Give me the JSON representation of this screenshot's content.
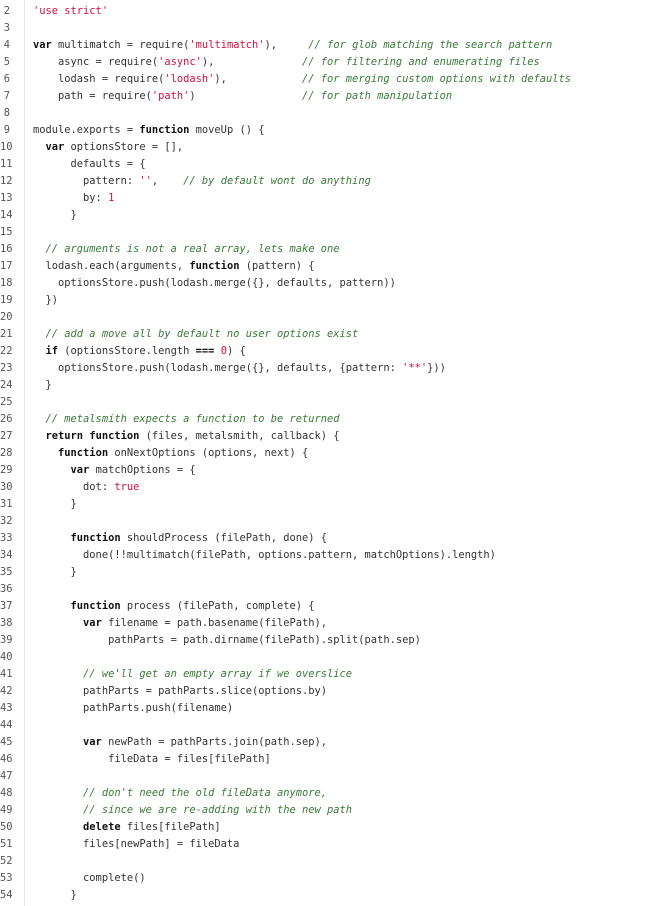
{
  "colors": {
    "background": "#ffffff",
    "plain": "#333333",
    "keyword": "#111111",
    "string": "#d01040",
    "number": "#d01040",
    "comment": "#3a7a3a",
    "line_number": "#555555",
    "gutter_rule": "#e4e4e4"
  },
  "lines": [
    {
      "n": "2",
      "tokens": [
        {
          "t": "string",
          "v": "'use strict'"
        }
      ]
    },
    {
      "n": "3",
      "tokens": []
    },
    {
      "n": "4",
      "tokens": [
        {
          "t": "keyword",
          "v": "var"
        },
        {
          "t": "plain",
          "v": " multimatch = require("
        },
        {
          "t": "string",
          "v": "'multimatch'"
        },
        {
          "t": "plain",
          "v": "),     "
        },
        {
          "t": "comment",
          "v": "// for glob matching the search pattern"
        }
      ]
    },
    {
      "n": "5",
      "tokens": [
        {
          "t": "plain",
          "v": "    async = require("
        },
        {
          "t": "string",
          "v": "'async'"
        },
        {
          "t": "plain",
          "v": "),              "
        },
        {
          "t": "comment",
          "v": "// for filtering and enumerating files"
        }
      ]
    },
    {
      "n": "6",
      "tokens": [
        {
          "t": "plain",
          "v": "    lodash = require("
        },
        {
          "t": "string",
          "v": "'lodash'"
        },
        {
          "t": "plain",
          "v": "),            "
        },
        {
          "t": "comment",
          "v": "// for merging custom options with defaults"
        }
      ]
    },
    {
      "n": "7",
      "tokens": [
        {
          "t": "plain",
          "v": "    path = require("
        },
        {
          "t": "string",
          "v": "'path'"
        },
        {
          "t": "plain",
          "v": ")                 "
        },
        {
          "t": "comment",
          "v": "// for path manipulation"
        }
      ]
    },
    {
      "n": "8",
      "tokens": []
    },
    {
      "n": "9",
      "tokens": [
        {
          "t": "plain",
          "v": "module.exports = "
        },
        {
          "t": "keyword",
          "v": "function"
        },
        {
          "t": "plain",
          "v": " moveUp () {"
        }
      ]
    },
    {
      "n": "10",
      "tokens": [
        {
          "t": "plain",
          "v": "  "
        },
        {
          "t": "keyword",
          "v": "var"
        },
        {
          "t": "plain",
          "v": " optionsStore = [],"
        }
      ]
    },
    {
      "n": "11",
      "tokens": [
        {
          "t": "plain",
          "v": "      defaults = {"
        }
      ]
    },
    {
      "n": "12",
      "tokens": [
        {
          "t": "plain",
          "v": "        pattern: "
        },
        {
          "t": "string",
          "v": "''"
        },
        {
          "t": "plain",
          "v": ",    "
        },
        {
          "t": "comment",
          "v": "// by default wont do anything"
        }
      ]
    },
    {
      "n": "13",
      "tokens": [
        {
          "t": "plain",
          "v": "        by: "
        },
        {
          "t": "number",
          "v": "1"
        }
      ]
    },
    {
      "n": "14",
      "tokens": [
        {
          "t": "plain",
          "v": "      }"
        }
      ]
    },
    {
      "n": "15",
      "tokens": []
    },
    {
      "n": "16",
      "tokens": [
        {
          "t": "plain",
          "v": "  "
        },
        {
          "t": "comment",
          "v": "// arguments is not a real array, lets make one"
        }
      ]
    },
    {
      "n": "17",
      "tokens": [
        {
          "t": "plain",
          "v": "  lodash.each(arguments, "
        },
        {
          "t": "keyword",
          "v": "function"
        },
        {
          "t": "plain",
          "v": " (pattern) {"
        }
      ]
    },
    {
      "n": "18",
      "tokens": [
        {
          "t": "plain",
          "v": "    optionsStore.push(lodash.merge({}, defaults, pattern))"
        }
      ]
    },
    {
      "n": "19",
      "tokens": [
        {
          "t": "plain",
          "v": "  })"
        }
      ]
    },
    {
      "n": "20",
      "tokens": []
    },
    {
      "n": "21",
      "tokens": [
        {
          "t": "plain",
          "v": "  "
        },
        {
          "t": "comment",
          "v": "// add a move all by default no user options exist"
        }
      ]
    },
    {
      "n": "22",
      "tokens": [
        {
          "t": "plain",
          "v": "  "
        },
        {
          "t": "keyword",
          "v": "if"
        },
        {
          "t": "plain",
          "v": " (optionsStore.length "
        },
        {
          "t": "keyword",
          "v": "==="
        },
        {
          "t": "plain",
          "v": " "
        },
        {
          "t": "number",
          "v": "0"
        },
        {
          "t": "plain",
          "v": ") {"
        }
      ]
    },
    {
      "n": "23",
      "tokens": [
        {
          "t": "plain",
          "v": "    optionsStore.push(lodash.merge({}, defaults, {pattern: "
        },
        {
          "t": "string",
          "v": "'**'"
        },
        {
          "t": "plain",
          "v": "}))"
        }
      ]
    },
    {
      "n": "24",
      "tokens": [
        {
          "t": "plain",
          "v": "  }"
        }
      ]
    },
    {
      "n": "25",
      "tokens": []
    },
    {
      "n": "26",
      "tokens": [
        {
          "t": "plain",
          "v": "  "
        },
        {
          "t": "comment",
          "v": "// metalsmith expects a function to be returned"
        }
      ]
    },
    {
      "n": "27",
      "tokens": [
        {
          "t": "plain",
          "v": "  "
        },
        {
          "t": "keyword",
          "v": "return"
        },
        {
          "t": "plain",
          "v": " "
        },
        {
          "t": "keyword",
          "v": "function"
        },
        {
          "t": "plain",
          "v": " (files, metalsmith, callback) {"
        }
      ]
    },
    {
      "n": "28",
      "tokens": [
        {
          "t": "plain",
          "v": "    "
        },
        {
          "t": "keyword",
          "v": "function"
        },
        {
          "t": "plain",
          "v": " onNextOptions (options, next) {"
        }
      ]
    },
    {
      "n": "29",
      "tokens": [
        {
          "t": "plain",
          "v": "      "
        },
        {
          "t": "keyword",
          "v": "var"
        },
        {
          "t": "plain",
          "v": " matchOptions = {"
        }
      ]
    },
    {
      "n": "30",
      "tokens": [
        {
          "t": "plain",
          "v": "        dot: "
        },
        {
          "t": "string",
          "v": "true"
        }
      ]
    },
    {
      "n": "31",
      "tokens": [
        {
          "t": "plain",
          "v": "      }"
        }
      ]
    },
    {
      "n": "32",
      "tokens": []
    },
    {
      "n": "33",
      "tokens": [
        {
          "t": "plain",
          "v": "      "
        },
        {
          "t": "keyword",
          "v": "function"
        },
        {
          "t": "plain",
          "v": " shouldProcess (filePath, done) {"
        }
      ]
    },
    {
      "n": "34",
      "tokens": [
        {
          "t": "plain",
          "v": "        done(!!multimatch(filePath, options.pattern, matchOptions).length)"
        }
      ]
    },
    {
      "n": "35",
      "tokens": [
        {
          "t": "plain",
          "v": "      }"
        }
      ]
    },
    {
      "n": "36",
      "tokens": []
    },
    {
      "n": "37",
      "tokens": [
        {
          "t": "plain",
          "v": "      "
        },
        {
          "t": "keyword",
          "v": "function"
        },
        {
          "t": "plain",
          "v": " process (filePath, complete) {"
        }
      ]
    },
    {
      "n": "38",
      "tokens": [
        {
          "t": "plain",
          "v": "        "
        },
        {
          "t": "keyword",
          "v": "var"
        },
        {
          "t": "plain",
          "v": " filename = path.basename(filePath),"
        }
      ]
    },
    {
      "n": "39",
      "tokens": [
        {
          "t": "plain",
          "v": "            pathParts = path.dirname(filePath).split(path.sep)"
        }
      ]
    },
    {
      "n": "40",
      "tokens": []
    },
    {
      "n": "41",
      "tokens": [
        {
          "t": "plain",
          "v": "        "
        },
        {
          "t": "comment",
          "v": "// we'll get an empty array if we overslice"
        }
      ]
    },
    {
      "n": "42",
      "tokens": [
        {
          "t": "plain",
          "v": "        pathParts = pathParts.slice(options.by)"
        }
      ]
    },
    {
      "n": "43",
      "tokens": [
        {
          "t": "plain",
          "v": "        pathParts.push(filename)"
        }
      ]
    },
    {
      "n": "44",
      "tokens": []
    },
    {
      "n": "45",
      "tokens": [
        {
          "t": "plain",
          "v": "        "
        },
        {
          "t": "keyword",
          "v": "var"
        },
        {
          "t": "plain",
          "v": " newPath = pathParts.join(path.sep),"
        }
      ]
    },
    {
      "n": "46",
      "tokens": [
        {
          "t": "plain",
          "v": "            fileData = files[filePath]"
        }
      ]
    },
    {
      "n": "47",
      "tokens": []
    },
    {
      "n": "48",
      "tokens": [
        {
          "t": "plain",
          "v": "        "
        },
        {
          "t": "comment",
          "v": "// don't need the old fileData anymore,"
        }
      ]
    },
    {
      "n": "49",
      "tokens": [
        {
          "t": "plain",
          "v": "        "
        },
        {
          "t": "comment",
          "v": "// since we are re-adding with the new path"
        }
      ]
    },
    {
      "n": "50",
      "tokens": [
        {
          "t": "plain",
          "v": "        "
        },
        {
          "t": "keyword",
          "v": "delete"
        },
        {
          "t": "plain",
          "v": " files[filePath]"
        }
      ]
    },
    {
      "n": "51",
      "tokens": [
        {
          "t": "plain",
          "v": "        files[newPath] = fileData"
        }
      ]
    },
    {
      "n": "52",
      "tokens": []
    },
    {
      "n": "53",
      "tokens": [
        {
          "t": "plain",
          "v": "        complete()"
        }
      ]
    },
    {
      "n": "54",
      "tokens": [
        {
          "t": "plain",
          "v": "      }"
        }
      ]
    }
  ]
}
